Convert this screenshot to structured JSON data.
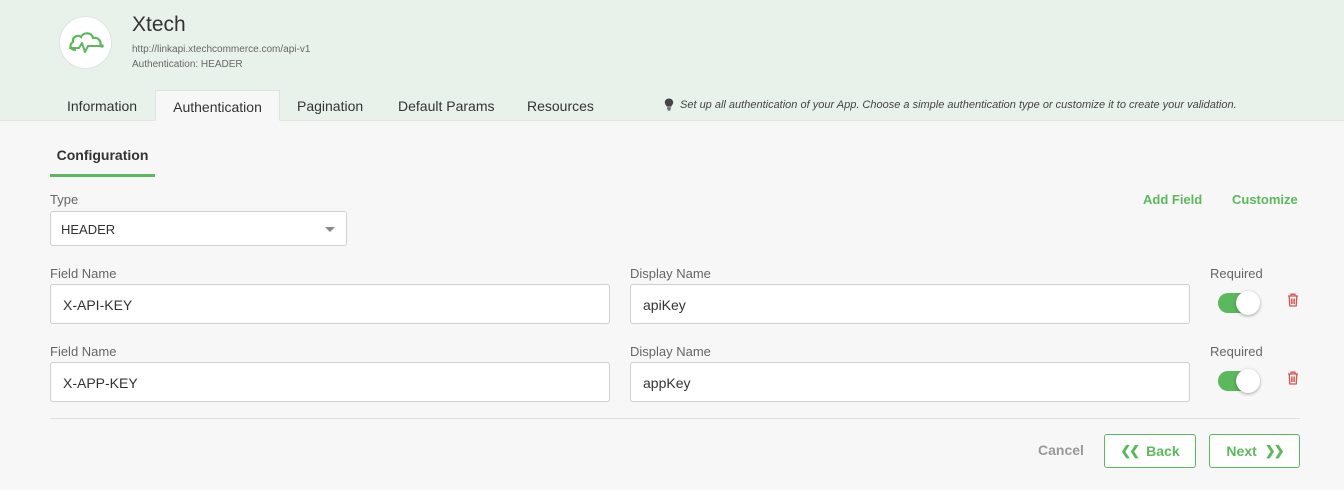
{
  "app": {
    "name": "Xtech",
    "url": "http://linkapi.xtechcommerce.com/api-v1",
    "auth_line": "Authentication: HEADER"
  },
  "tabs": [
    {
      "label": "Information",
      "active": false
    },
    {
      "label": "Authentication",
      "active": true
    },
    {
      "label": "Pagination",
      "active": false
    },
    {
      "label": "Default Params",
      "active": false
    },
    {
      "label": "Resources",
      "active": false
    }
  ],
  "hint": "Set up all authentication of your App. Choose a simple authentication type or customize it to create your validation.",
  "subtab": "Configuration",
  "type": {
    "label": "Type",
    "value": "HEADER"
  },
  "actions": {
    "add_field": "Add Field",
    "customize": "Customize"
  },
  "fields": [
    {
      "field_name_label": "Field Name",
      "field_name": "X-API-KEY",
      "display_name_label": "Display Name",
      "display_name": "apiKey",
      "required_label": "Required",
      "required": true
    },
    {
      "field_name_label": "Field Name",
      "field_name": "X-APP-KEY",
      "display_name_label": "Display Name",
      "display_name": "appKey",
      "required_label": "Required",
      "required": true
    }
  ],
  "footer": {
    "cancel": "Cancel",
    "back": "Back",
    "next": "Next"
  },
  "colors": {
    "accent": "#5cb85c",
    "header_bg": "#e9f2ea",
    "danger": "#d9534f"
  },
  "icons": {
    "logo": "cloud-logo-icon",
    "hint": "lightbulb-icon",
    "delete": "trash-icon",
    "back": "double-chevron-left-icon",
    "next": "double-chevron-right-icon",
    "dropdown": "caret-down-icon"
  }
}
